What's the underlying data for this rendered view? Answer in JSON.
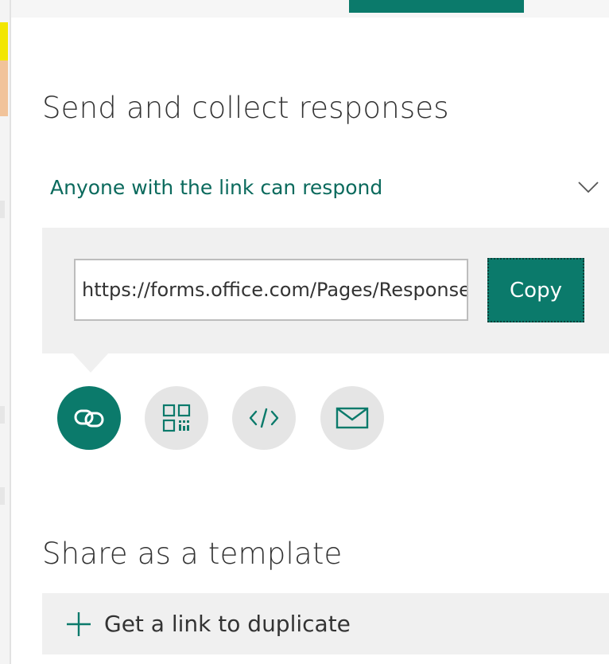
{
  "colors": {
    "accent": "#0b7a6b",
    "accent_text": "#0b6a5d",
    "panel_bg": "#f0f0f0",
    "inactive_circle": "#e5e5e5"
  },
  "send": {
    "title": "Send and collect responses",
    "permission": {
      "label": "Anyone with the link can respond",
      "icon": "chevron-down-icon"
    },
    "link": {
      "url": "https://forms.office.com/Pages/ResponsePage.aspx",
      "copy_label": "Copy"
    },
    "share_options": [
      {
        "icon": "link-icon",
        "active": true
      },
      {
        "icon": "qr-code-icon",
        "active": false
      },
      {
        "icon": "embed-code-icon",
        "active": false
      },
      {
        "icon": "mail-icon",
        "active": false
      }
    ]
  },
  "template": {
    "title": "Share as a template",
    "action_label": "Get a link to duplicate",
    "action_icon": "plus-icon"
  }
}
